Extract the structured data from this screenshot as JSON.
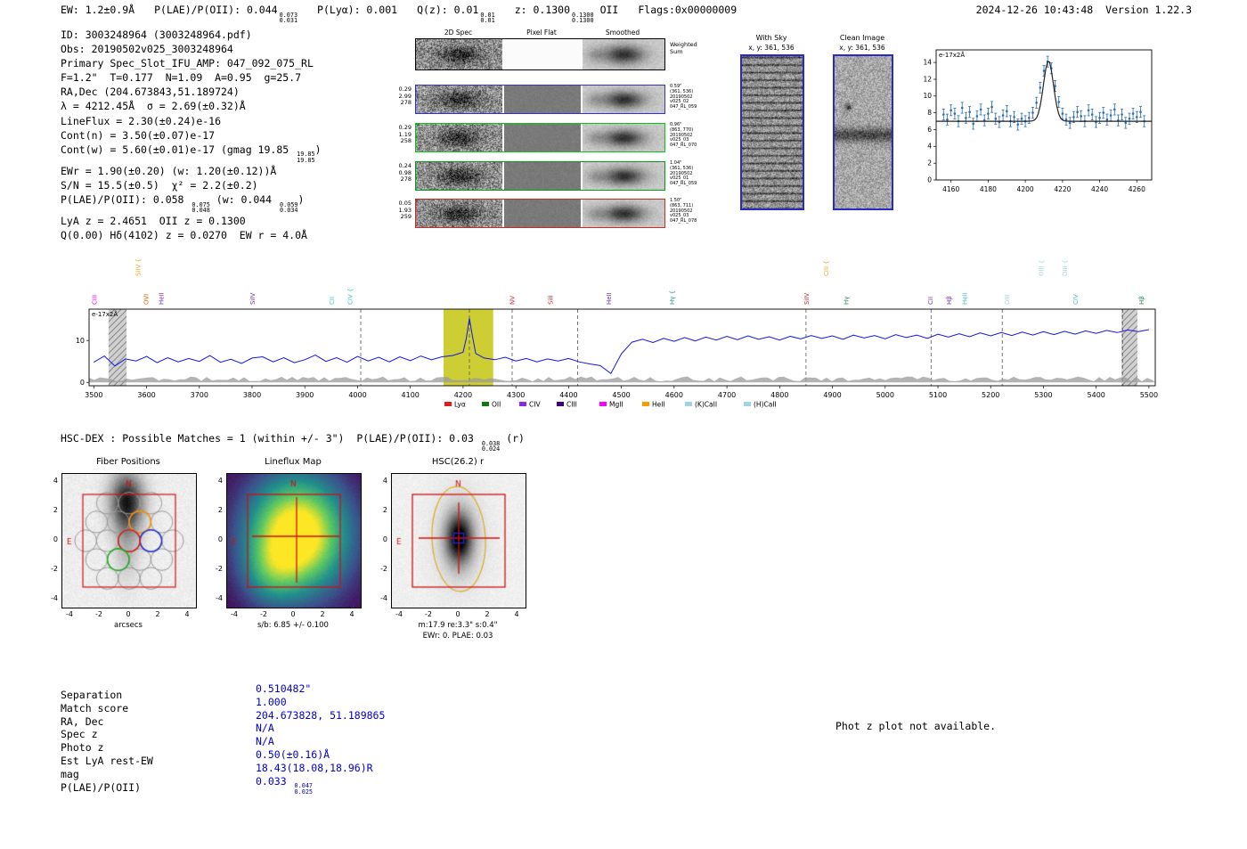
{
  "header": {
    "ew": "EW: 1.2±0.9Å",
    "plae": {
      "pre": "P(LAE)/P(OII): 0.044",
      "sup": "0.073",
      "sub": "0.031"
    },
    "plya": "P(Lyα): 0.001",
    "qz": {
      "pre": "Q(z): 0.01",
      "sup": "0.01",
      "sub": "0.01"
    },
    "z": {
      "pre": "z: 0.1300",
      "sup": "0.1300",
      "sub": "0.1300",
      "post": "OII"
    },
    "flags": "Flags:0x00000009",
    "timestamp": "2024-12-26 10:43:48  Version 1.22.3"
  },
  "info_lines": [
    [
      {
        "t": "ID: 3003248964 (3003248964.pdf)"
      }
    ],
    [
      {
        "t": "Obs: 20190502v025_3003248964"
      }
    ],
    [
      {
        "t": "Primary Spec_Slot_IFU_AMP: 047_092_075_RL"
      }
    ],
    [
      {
        "t": "F=1.2\"  T=0.177  N=1.09  A=0.95  g=25.7"
      }
    ],
    [
      {
        "t": "RA,Dec (204.673843,51.189724)"
      }
    ],
    [
      {
        "t": "λ = 4212.45Å  σ = 2.69(±0.32)Å"
      }
    ],
    [
      {
        "t": "LineFlux = 2.30(±0.24)e-16"
      }
    ],
    [
      {
        "t": "Cont(n) = 3.50(±0.07)e-17"
      }
    ],
    [
      {
        "t": "Cont(w) = 5.60(±0.01)e-17 (gmag 19.85 "
      },
      {
        "sup": "19.85",
        "sub": "19.85"
      },
      {
        "t": ")"
      }
    ],
    [
      {
        "t": "EWr = 1.90(±0.20) (w: 1.20(±0.12))Å"
      }
    ],
    [
      {
        "t": "S/N = 15.5(±0.5)  χ² = 2.2(±0.2)"
      }
    ],
    [
      {
        "t": "P(LAE)/P(OII): 0.058 "
      },
      {
        "sup": "0.075",
        "sub": "0.048"
      },
      {
        "t": " (w: 0.044 "
      },
      {
        "sup": "0.059",
        "sub": "0.034"
      },
      {
        "t": ")"
      }
    ],
    [
      {
        "t": "LyA z = 2.4651  OII z = 0.1300"
      }
    ],
    [
      {
        "t": "Q(0.00) Hδ(4102) z = 0.0270  EW r = 4.0Å"
      }
    ]
  ],
  "spec2d": {
    "col_headers": [
      "2D Spec",
      "Pixel Flat",
      "Smoothed"
    ],
    "rows": [
      {
        "border": "#000000",
        "left": [],
        "right": [
          "Weighted",
          "Sum"
        ]
      },
      {
        "border": "#3333cc",
        "left": [
          "0.29",
          "2.99",
          "278"
        ],
        "right": [
          "0.59\"",
          "(361, 536)",
          "20190502",
          "v025_02",
          "047_RL_059"
        ]
      },
      {
        "border": "#00c814",
        "left": [
          "0.29",
          "1.19",
          "258"
        ],
        "right": [
          "0.96\"",
          "(863, 770)",
          "20190502",
          "v025_03",
          "047_RL_070"
        ]
      },
      {
        "border": "#00a014",
        "left": [
          "0.24",
          "0.98",
          "278"
        ],
        "right": [
          "1.04\"",
          "(361, 536)",
          "20190502",
          "v025_01",
          "047_RL_059"
        ]
      },
      {
        "border": "#d42a1e",
        "left": [
          "0.05",
          "1.93",
          "259"
        ],
        "right": [
          "1.50\"",
          "(863, 711)",
          "20190502",
          "v025_03",
          "047_RL_078"
        ]
      }
    ]
  },
  "with_sky": {
    "title": "With Sky",
    "subtitle": "x, y: 361, 536"
  },
  "clean_image": {
    "title": "Clean Image",
    "subtitle": "x, y: 361, 536"
  },
  "chart_data": [
    {
      "type": "line",
      "name": "emission-line-fit",
      "ylabel": "e-17x2Å",
      "xlim": [
        4152,
        4268
      ],
      "ylim": [
        0,
        15.5
      ],
      "xticks": [
        4160,
        4180,
        4200,
        4220,
        4240,
        4260
      ],
      "yticks": [
        0,
        2,
        4,
        6,
        8,
        10,
        12,
        14
      ],
      "series": [
        {
          "name": "observed",
          "style": "errorbar-points",
          "color": "#2b6cb0",
          "yerr": 0.65,
          "x": [
            4156,
            4158,
            4160,
            4162,
            4164,
            4166,
            4168,
            4170,
            4172,
            4174,
            4176,
            4178,
            4180,
            4182,
            4184,
            4186,
            4188,
            4190,
            4192,
            4194,
            4196,
            4198,
            4200,
            4202,
            4204,
            4206,
            4208,
            4210,
            4212,
            4214,
            4216,
            4218,
            4220,
            4222,
            4224,
            4226,
            4228,
            4230,
            4232,
            4234,
            4236,
            4238,
            4240,
            4242,
            4244,
            4246,
            4248,
            4250,
            4252,
            4254,
            4256,
            4258,
            4260,
            4262,
            4264
          ],
          "y": [
            7.8,
            7.2,
            8.3,
            7.9,
            7.0,
            8.6,
            7.4,
            8.1,
            6.7,
            7.6,
            8.4,
            7.1,
            7.9,
            8.7,
            7.3,
            6.9,
            7.7,
            8.2,
            7.0,
            7.5,
            6.6,
            7.3,
            7.0,
            7.4,
            8.0,
            9.2,
            11.0,
            13.0,
            14.1,
            13.3,
            11.2,
            9.3,
            7.9,
            7.2,
            6.8,
            7.5,
            8.1,
            7.6,
            7.0,
            8.3,
            7.8,
            6.9,
            7.4,
            8.0,
            7.2,
            7.7,
            8.4,
            7.1,
            7.8,
            6.8,
            7.3,
            7.9,
            7.5,
            8.1,
            7.0
          ]
        },
        {
          "name": "gaussian-fit",
          "style": "line",
          "color": "#222222",
          "center": 4212.45,
          "sigma": 2.69,
          "continuum": 7.0,
          "peak": 14.2
        }
      ]
    },
    {
      "type": "line",
      "name": "full-spectrum",
      "ylabel": "e-17x2Å",
      "xlim": [
        3491,
        5512
      ],
      "ylim": [
        -0.8,
        17.5
      ],
      "xticks": [
        3500,
        3600,
        3700,
        3800,
        3900,
        4000,
        4100,
        4200,
        4300,
        4400,
        4500,
        4600,
        4700,
        4800,
        4900,
        5000,
        5100,
        5200,
        5300,
        5400,
        5500
      ],
      "yticks": [
        0,
        10
      ],
      "series": [
        {
          "name": "spectrum",
          "color": "#1414e6",
          "x": [
            3500,
            3520,
            3540,
            3560,
            3580,
            3600,
            3620,
            3640,
            3660,
            3680,
            3700,
            3720,
            3740,
            3760,
            3780,
            3800,
            3820,
            3840,
            3860,
            3880,
            3900,
            3920,
            3940,
            3960,
            3980,
            4000,
            4020,
            4040,
            4060,
            4080,
            4100,
            4120,
            4140,
            4160,
            4180,
            4200,
            4206,
            4212,
            4218,
            4224,
            4240,
            4260,
            4280,
            4300,
            4320,
            4340,
            4360,
            4380,
            4400,
            4420,
            4440,
            4460,
            4480,
            4500,
            4520,
            4540,
            4560,
            4580,
            4600,
            4620,
            4640,
            4660,
            4680,
            4700,
            4720,
            4740,
            4760,
            4780,
            4800,
            4820,
            4840,
            4860,
            4880,
            4900,
            4920,
            4940,
            4960,
            4980,
            5000,
            5020,
            5040,
            5060,
            5080,
            5100,
            5120,
            5140,
            5160,
            5180,
            5200,
            5220,
            5240,
            5260,
            5280,
            5300,
            5320,
            5340,
            5360,
            5380,
            5400,
            5420,
            5440,
            5460,
            5480,
            5500
          ],
          "y": [
            4.8,
            6.3,
            3.9,
            5.6,
            5.1,
            6.2,
            4.7,
            5.9,
            4.9,
            5.7,
            5.0,
            6.4,
            4.8,
            5.5,
            4.5,
            5.8,
            6.1,
            4.9,
            5.9,
            4.7,
            5.4,
            6.5,
            5.0,
            5.9,
            4.8,
            6.2,
            5.1,
            6.0,
            4.9,
            6.1,
            5.2,
            6.3,
            5.4,
            6.1,
            6.4,
            7.2,
            10.5,
            15.3,
            10.8,
            6.9,
            5.8,
            5.4,
            6.0,
            5.1,
            5.7,
            4.9,
            5.6,
            5.1,
            5.7,
            4.9,
            4.4,
            4.0,
            2.1,
            6.8,
            9.6,
            10.3,
            9.5,
            10.5,
            9.8,
            10.7,
            9.9,
            10.8,
            10.1,
            11.0,
            10.2,
            11.1,
            10.3,
            10.9,
            10.1,
            11.0,
            10.4,
            11.2,
            10.5,
            11.1,
            10.3,
            11.3,
            10.6,
            11.2,
            10.4,
            11.4,
            10.7,
            11.3,
            10.5,
            11.5,
            10.8,
            11.6,
            10.9,
            11.8,
            11.1,
            11.9,
            11.2,
            12.0,
            11.3,
            12.1,
            11.4,
            12.2,
            11.5,
            12.3,
            11.7,
            12.4,
            11.9,
            12.5,
            12.1,
            12.6
          ]
        }
      ],
      "highlight_band": {
        "x0": 4163,
        "x1": 4257,
        "color": "#c8c81e"
      },
      "masked_bands": [
        {
          "x0": 3528,
          "x1": 3562
        },
        {
          "x0": 5448,
          "x1": 5478
        }
      ],
      "dashed_lines": [
        4006,
        4212,
        4293,
        4417,
        4850,
        5087,
        5222,
        5450
      ],
      "line_labels": [
        {
          "wl": 3505,
          "label": "CIII",
          "color": "#e000e0",
          "tall": false
        },
        {
          "wl": 3588,
          "label": "SiIV {",
          "color": "#f5a623",
          "tall": true
        },
        {
          "wl": 3603,
          "label": "OVI",
          "color": "#e05a00",
          "tall": false
        },
        {
          "wl": 3632,
          "label": "HeII",
          "color": "#8030b0",
          "tall": false
        },
        {
          "wl": 3805,
          "label": "SiIV",
          "color": "#8030b0",
          "tall": false
        },
        {
          "wl": 3955,
          "label": "CII",
          "color": "#45c0c8",
          "tall": false
        },
        {
          "wl": 3990,
          "label": "CIV {",
          "color": "#45c0c8",
          "tall": false
        },
        {
          "wl": 4297,
          "label": "NV",
          "color": "#d62728",
          "tall": false
        },
        {
          "wl": 4370,
          "label": "SiII",
          "color": "#d62728",
          "tall": false
        },
        {
          "wl": 4480,
          "label": "HeII",
          "color": "#8030b0",
          "tall": false
        },
        {
          "wl": 4600,
          "label": "Hγ {",
          "color": "#2a9d8f",
          "tall": false
        },
        {
          "wl": 4855,
          "label": "SiIV",
          "color": "#d62728",
          "tall": false
        },
        {
          "wl": 4892,
          "label": "CIII {",
          "color": "#f5a623",
          "tall": true
        },
        {
          "wl": 4930,
          "label": "Hγ",
          "color": "#2e8b57",
          "tall": false
        },
        {
          "wl": 5090,
          "label": "CII",
          "color": "#8030b0",
          "tall": false
        },
        {
          "wl": 5125,
          "label": "Hβ",
          "color": "#8030b0",
          "tall": false
        },
        {
          "wl": 5155,
          "label": "HeII",
          "color": "#45c0c8",
          "tall": false
        },
        {
          "wl": 5235,
          "label": "OIII",
          "color": "#9fd4e8",
          "tall": false
        },
        {
          "wl": 5300,
          "label": "OIII {",
          "color": "#9fd4e8",
          "tall": true
        },
        {
          "wl": 5345,
          "label": "OIII {",
          "color": "#9fd4e8",
          "tall": true
        },
        {
          "wl": 5365,
          "label": "CIV",
          "color": "#45c0c8",
          "tall": false
        },
        {
          "wl": 5490,
          "label": "Hβ",
          "color": "#2e8b57",
          "tall": false
        }
      ],
      "legend": [
        {
          "label": "Lyα",
          "color": "#e41a1c"
        },
        {
          "label": "OII",
          "color": "#0f7a0f"
        },
        {
          "label": "CIV",
          "color": "#8a2be2"
        },
        {
          "label": "CIII",
          "color": "#3f007d"
        },
        {
          "label": "MgII",
          "color": "#ff00ff"
        },
        {
          "label": "HeII",
          "color": "#ff9900"
        },
        {
          "label": "(K)CaII",
          "color": "#9fd4e8"
        },
        {
          "label": "(H)CaII",
          "color": "#9fd4e8"
        }
      ]
    }
  ],
  "hsc_line": {
    "pre": "HSC-DEX : Possible Matches = 1 (within +/- 3\")  P(LAE)/P(OII): 0.03 ",
    "sup": "0.038",
    "sub": "0.024",
    "post": " (r)"
  },
  "cutouts": [
    {
      "title": "Fiber Positions",
      "compass": [
        "N",
        "E"
      ],
      "captions": [
        "arcsecs"
      ]
    },
    {
      "title": "Lineflux Map",
      "compass": [
        "N",
        "E"
      ],
      "captions": [
        "s/b: 6.85 +/- 0.100"
      ]
    },
    {
      "title": "HSC(26.2) r",
      "compass": [
        "N",
        "E"
      ],
      "captions": [
        "m:17.9 re:3.3\" s:0.4\"",
        "EWr: 0. PLAE: 0.03"
      ]
    }
  ],
  "axis_ticks": [
    -4,
    -2,
    0,
    2,
    4
  ],
  "cutout_style": {
    "square": "#cc1111",
    "compass": "#cc1111",
    "fibers": [
      "#ff8c00",
      "#2233cc",
      "#cc2222",
      "#22aa22"
    ],
    "ellipse": "#dfa920",
    "center_box": "#2222cc"
  },
  "match_table": {
    "value_color": "#0000cd",
    "rows": [
      {
        "label": "Separation",
        "value": "0.510482\""
      },
      {
        "label": "Match score",
        "value": "1.000"
      },
      {
        "label": "RA, Dec",
        "value": "204.673828, 51.189865"
      },
      {
        "label": "Spec z",
        "value": "N/A"
      },
      {
        "label": "Photo z",
        "value": "N/A"
      },
      {
        "label": "Est LyA rest-EW",
        "value": "0.50(±0.16)Å"
      },
      {
        "label": "mag",
        "value": "18.43(18.08,18.96)R"
      },
      {
        "label": "P(LAE)/P(OII)",
        "value": "0.033 ",
        "sup": "0.047",
        "sub": "0.025"
      }
    ]
  },
  "photz_note": "Phot z plot not available."
}
